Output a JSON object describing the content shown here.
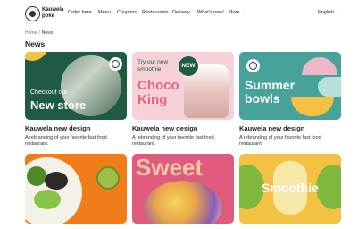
{
  "brand": {
    "name": "Kauwela poké"
  },
  "nav": {
    "items": [
      {
        "label": "Order here"
      },
      {
        "label": "Menu"
      },
      {
        "label": "Coupons"
      },
      {
        "label": "Restaurants"
      },
      {
        "label": "Delivery"
      },
      {
        "label": "What's new!"
      },
      {
        "label": "More"
      }
    ],
    "language": "English"
  },
  "breadcrumb": {
    "home": "Home",
    "separator": "/",
    "current": "News"
  },
  "page": {
    "title": "News"
  },
  "cards": [
    {
      "heading_small": "Checkout our",
      "heading_large": "New store",
      "title": "Kauwela new design",
      "description": "A rebranding of your favorite fast food restaurant."
    },
    {
      "intro": "Try our new smoothie",
      "heading_large": "Choco King",
      "badge": "NEW",
      "title": "Kauwela new design",
      "description": "A rebranding of your favorite fast food restaurant."
    },
    {
      "heading_large": "Summer bowls",
      "title": "Kauwela new design",
      "description": "A rebranding of your favorite fast food restaurant."
    },
    {},
    {
      "heading_large": "Sweet"
    },
    {
      "heading_large": "Smoothie"
    }
  ],
  "colors": {
    "green_dark": "#1f5a45",
    "pink_light": "#f6d2d8",
    "pink_text": "#e8628a",
    "teal": "#47a39a",
    "orange": "#f07c1a",
    "pink_hot": "#e05a7e",
    "yellow": "#f3c244"
  }
}
